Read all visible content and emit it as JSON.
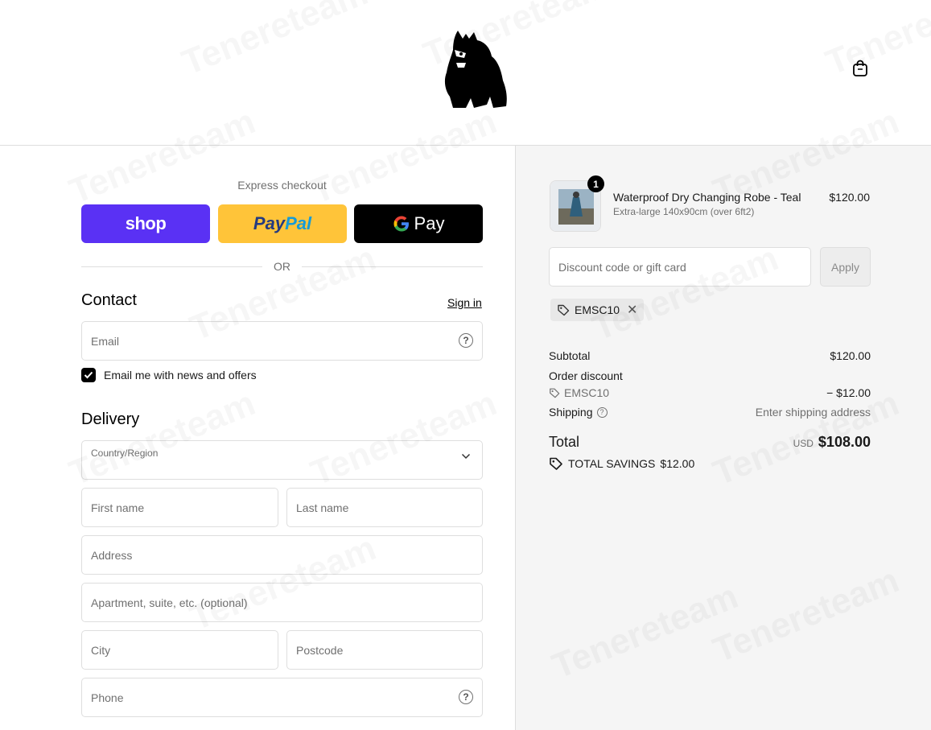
{
  "header": {
    "logo_name": "gorilla-logo",
    "cart_icon": "shopping-bag-icon"
  },
  "express": {
    "title": "Express checkout",
    "shop_label": "shop",
    "paypal_label_1": "Pay",
    "paypal_label_2": "Pal",
    "gpay_label": "Pay",
    "or": "OR"
  },
  "contact": {
    "title": "Contact",
    "sign_in": "Sign in",
    "email_placeholder": "Email",
    "newsletter_label": "Email me with news and offers",
    "newsletter_checked": true
  },
  "delivery": {
    "title": "Delivery",
    "country_label": "Country/Region",
    "first_name": "First name",
    "last_name": "Last name",
    "address": "Address",
    "apartment": "Apartment, suite, etc. (optional)",
    "city": "City",
    "postcode": "Postcode",
    "phone": "Phone"
  },
  "order": {
    "quantity": "1",
    "product_name": "Waterproof Dry Changing Robe - Teal",
    "variant": "Extra-large 140x90cm (over 6ft2)",
    "price": "$120.00",
    "discount_placeholder": "Discount code or gift card",
    "apply": "Apply",
    "applied_code": "EMSC10"
  },
  "summary": {
    "subtotal_label": "Subtotal",
    "subtotal_value": "$120.00",
    "order_discount_label": "Order discount",
    "discount_code": "EMSC10",
    "discount_value": "− $12.00",
    "shipping_label": "Shipping",
    "shipping_value": "Enter shipping address",
    "total_label": "Total",
    "currency": "USD",
    "total_value": "$108.00",
    "savings_label": "TOTAL SAVINGS",
    "savings_value": "$12.00"
  },
  "watermark_text": "Tenereteam",
  "colors": {
    "shop": "#5a31f4",
    "paypal": "#ffc439",
    "gpay": "#000000",
    "summary_bg": "#f5f5f5"
  }
}
